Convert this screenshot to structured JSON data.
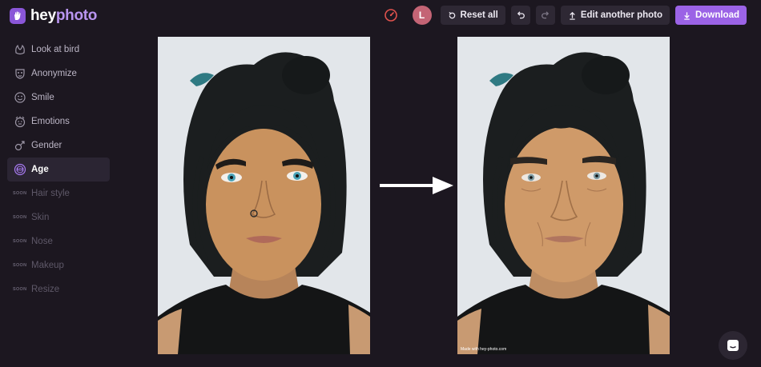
{
  "app": {
    "logo_part1": "hey",
    "logo_part2": "photo",
    "logo_icon": "hand-logo-icon"
  },
  "header": {
    "timer_icon": "speedometer-icon",
    "avatar_initial": "L",
    "reset_label": "Reset all",
    "undo_icon": "undo-icon",
    "redo_icon": "redo-icon",
    "edit_another_label": "Edit another photo",
    "download_label": "Download"
  },
  "sidebar": {
    "items": [
      {
        "label": "Look at bird",
        "icon": "bird-icon",
        "state": "normal"
      },
      {
        "label": "Anonymize",
        "icon": "mask-icon",
        "state": "normal"
      },
      {
        "label": "Smile",
        "icon": "smile-icon",
        "state": "normal"
      },
      {
        "label": "Emotions",
        "icon": "emotions-icon",
        "state": "normal"
      },
      {
        "label": "Gender",
        "icon": "gender-icon",
        "state": "normal"
      },
      {
        "label": "Age",
        "icon": "age-icon",
        "state": "active"
      },
      {
        "label": "Hair style",
        "soon": "SOON",
        "state": "soon"
      },
      {
        "label": "Skin",
        "soon": "SOON",
        "state": "soon"
      },
      {
        "label": "Nose",
        "soon": "SOON",
        "state": "soon"
      },
      {
        "label": "Makeup",
        "soon": "SOON",
        "state": "soon"
      },
      {
        "label": "Resize",
        "soon": "SOON",
        "state": "soon"
      }
    ]
  },
  "main": {
    "original_photo": "portrait-original",
    "edited_photo": "portrait-aged",
    "arrow_icon": "arrow-right-icon",
    "watermark": "Made with hey-photo.com"
  },
  "chat": {
    "icon": "chat-icon"
  },
  "colors": {
    "background": "#1c1720",
    "accent": "#9b63e6",
    "active_item": "#2b2533",
    "button": "#2e2834"
  }
}
